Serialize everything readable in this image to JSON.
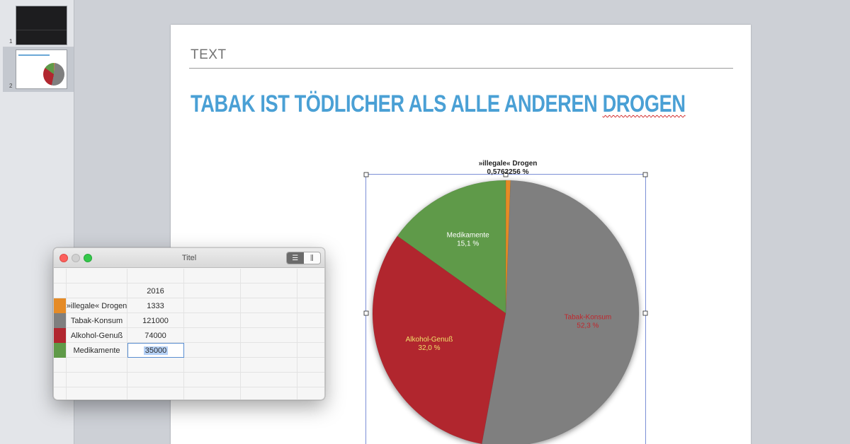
{
  "sidebar": {
    "slides": [
      {
        "number": "1"
      },
      {
        "number": "2"
      }
    ]
  },
  "slide": {
    "placeholder": "TEXT",
    "title_main": "TABAK IST TÖDLICHER ALS ALLE ANDEREN ",
    "title_spell": "DROGEN"
  },
  "chart_data": {
    "type": "pie",
    "categories": [
      "»illegale« Drogen",
      "Tabak-Konsum",
      "Alkohol-Genuß",
      "Medikamente"
    ],
    "values": [
      1333,
      121000,
      74000,
      35000
    ],
    "percent_labels": [
      "0,5762256 %",
      "52,3 %",
      "32,0 %",
      "15,1 %"
    ],
    "colors": [
      "#e58b27",
      "#7f7f7f",
      "#b1262f",
      "#5f9a48"
    ],
    "label_colors": [
      "#222222",
      "#c0272d",
      "#f0e06a",
      "#ffffff"
    ],
    "series_header": "2016"
  },
  "data_window": {
    "title": "Titel",
    "view_buttons": [
      "☰",
      "⫼"
    ],
    "header": "2016",
    "rows": [
      {
        "label": "»illegale« Drogen",
        "value": "1333",
        "color": "#e58b27"
      },
      {
        "label": "Tabak-Konsum",
        "value": "121000",
        "color": "#7f7f7f"
      },
      {
        "label": "Alkohol-Genuß",
        "value": "74000",
        "color": "#b1262f"
      },
      {
        "label": "Medikamente",
        "value": "35000",
        "color": "#5f9a48"
      }
    ]
  }
}
